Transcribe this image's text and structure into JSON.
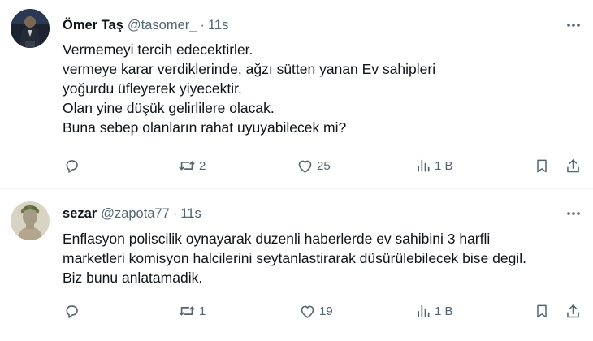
{
  "tweets": [
    {
      "author": {
        "name": "Ömer Taş",
        "handle": "@tasomer_"
      },
      "time": "11s",
      "separator": "·",
      "lines": [
        "Vermemeyi tercih edecektirler.",
        "vermeye karar verdiklerinde, ağzı sütten yanan Ev sahipleri",
        "yoğurdu üfleyerek yiyecektir.",
        "Olan yine düşük gelirlilere olacak.",
        "Buna sebep olanların rahat uyuyabilecek mi?"
      ],
      "stats": {
        "retweets": "2",
        "likes": "25",
        "views": "1 B"
      }
    },
    {
      "author": {
        "name": "sezar",
        "handle": "@zapota77"
      },
      "time": "11s",
      "separator": "·",
      "lines": [
        "Enflasyon poliscilik oynayarak duzenli haberlerde ev sahibini 3 harfli",
        "marketleri komisyon halcilerini seytanlastirarak düsürülebilecek bise degil.",
        "Biz bunu anlatamadik."
      ],
      "stats": {
        "retweets": "1",
        "likes": "19",
        "views": "1 B"
      }
    }
  ],
  "icons": {
    "reply": "reply-icon",
    "retweet": "retweet-icon",
    "like": "heart-icon",
    "views": "views-chart-icon",
    "bookmark": "bookmark-icon",
    "share": "share-icon",
    "more": "more-dots-icon"
  },
  "colors": {
    "text": "#0f1419",
    "secondary": "#536471",
    "divider": "#eff3f4"
  }
}
